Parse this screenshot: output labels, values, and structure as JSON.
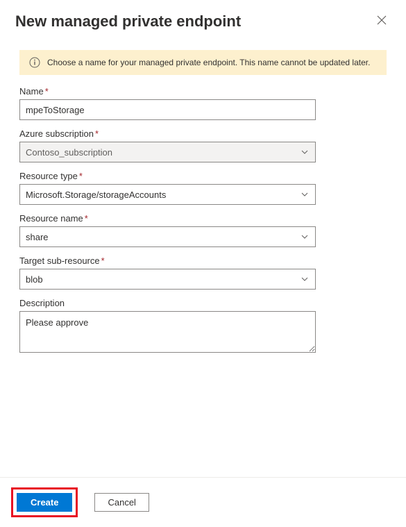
{
  "header": {
    "title": "New managed private endpoint"
  },
  "info": {
    "message": "Choose a name for your managed private endpoint. This name cannot be updated later."
  },
  "fields": {
    "name": {
      "label": "Name",
      "value": "mpeToStorage"
    },
    "subscription": {
      "label": "Azure subscription",
      "value": "Contoso_subscription"
    },
    "resourceType": {
      "label": "Resource type",
      "value": "Microsoft.Storage/storageAccounts"
    },
    "resourceName": {
      "label": "Resource name",
      "value": "share"
    },
    "targetSubResource": {
      "label": "Target sub-resource",
      "value": "blob"
    },
    "description": {
      "label": "Description",
      "value": "Please approve"
    }
  },
  "footer": {
    "create": "Create",
    "cancel": "Cancel"
  }
}
